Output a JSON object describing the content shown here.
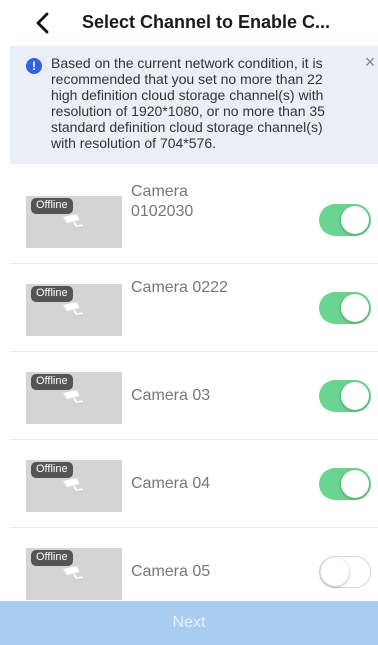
{
  "header": {
    "title": "Select Channel to Enable C..."
  },
  "notice": {
    "text": "Based on the current network condition, it is recommended that you set no more than 22 high definition cloud storage channel(s) with resolution of 1920*1080, or no more than 35 standard definition cloud storage channel(s) with resolution of 704*576."
  },
  "channels": [
    {
      "name": "Camera 0102030",
      "status": "Offline",
      "enabled": true
    },
    {
      "name": "Camera 0222",
      "status": "Offline",
      "enabled": true
    },
    {
      "name": "Camera 03",
      "status": "Offline",
      "enabled": true
    },
    {
      "name": "Camera 04",
      "status": "Offline",
      "enabled": true
    },
    {
      "name": "Camera 05",
      "status": "Offline",
      "enabled": false
    }
  ],
  "footer": {
    "next_label": "Next"
  },
  "colors": {
    "accent_blue": "#2f64e0",
    "toggle_on": "#6bd490",
    "next_button_bg": "#a9cdf0",
    "notice_bg": "#e9eef7"
  }
}
